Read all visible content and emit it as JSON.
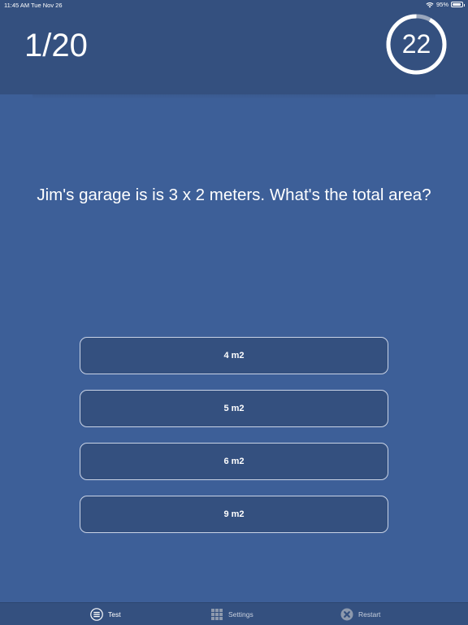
{
  "status_bar": {
    "time": "11:45 AM",
    "date": "Tue Nov 26",
    "battery": "95%",
    "battery_level": 0.95
  },
  "header": {
    "counter": "1/20",
    "timer_value": "22",
    "timer_remaining_fraction": 0.92
  },
  "question": "Jim's garage is is 3 x 2 meters. What's the total area?",
  "answers": [
    "4 m2",
    "5 m2",
    "6 m2",
    "9 m2"
  ],
  "tab_bar": {
    "tabs": [
      {
        "label": "Test",
        "icon": "list-icon",
        "active": true
      },
      {
        "label": "Settings",
        "icon": "grid-icon",
        "active": false
      },
      {
        "label": "Restart",
        "icon": "close-circle-icon",
        "active": false
      }
    ]
  },
  "colors": {
    "background": "#3d5f98",
    "header": "#34507f",
    "button": "#34507f",
    "button_border": "#c9d3e6",
    "text": "#ffffff"
  }
}
